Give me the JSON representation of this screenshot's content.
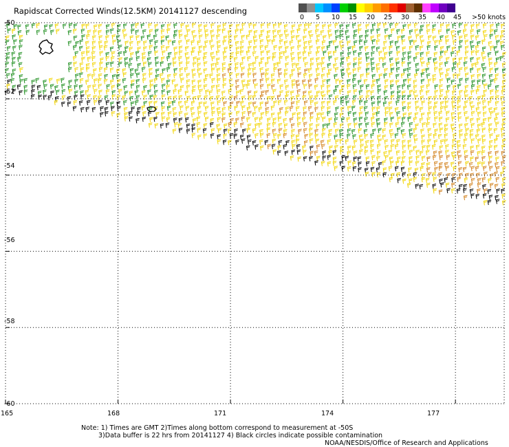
{
  "title": "Rapidscat Corrected Winds(12.5KM) 20141127 descending",
  "colorbar": {
    "colors": [
      "#505050",
      "#909090",
      "#00c8ff",
      "#0090ff",
      "#0040ff",
      "#00d000",
      "#009000",
      "#ffff00",
      "#ffd000",
      "#ff9c00",
      "#ff7000",
      "#ff3000",
      "#e00000",
      "#a06030",
      "#603000",
      "#ff40ff",
      "#c000ff",
      "#7000c0",
      "#400090"
    ],
    "labels": [
      "0",
      "5",
      "10",
      "15",
      "20",
      "25",
      "30",
      "35",
      "40",
      "45",
      ">50 knots"
    ]
  },
  "map": {
    "lat_labels": [
      "-50",
      "-52",
      "-54",
      "-56",
      "-58",
      "-60"
    ],
    "lon_labels": [
      "165",
      "168",
      "171",
      "174",
      "177"
    ],
    "lat_range": [
      -60,
      -50
    ],
    "lon_range": [
      165,
      178.3
    ],
    "wind_color_scale": {
      "green": "#1f8f1f",
      "yellow": "#f2d400",
      "orange": "#d2801a",
      "black": "#000000"
    }
  },
  "notes": {
    "line1": "Note: 1) Times are GMT 2)Times along bottom correspond to measurement at -50S",
    "line2": "3)Data buffer is 22 hrs from 20141127 4) Black circles indicate possible contamination",
    "line3": "NOAA/NESDIS/Office of Research and Applications"
  }
}
